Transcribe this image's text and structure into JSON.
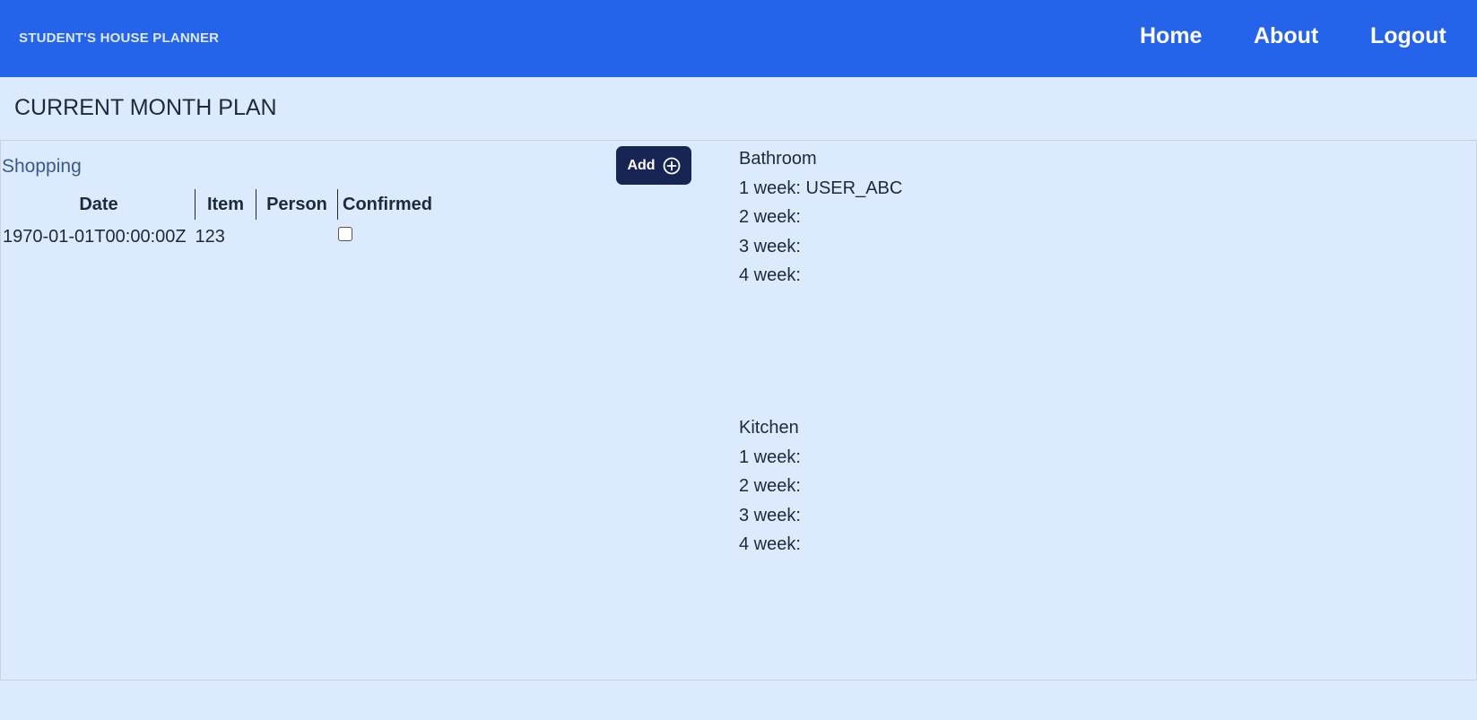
{
  "header": {
    "brand": "STUDENT'S HOUSE PLANNER",
    "nav": [
      "Home",
      "About",
      "Logout"
    ]
  },
  "page_title": "CURRENT MONTH PLAN",
  "shopping": {
    "title": "Shopping",
    "add_label": "Add",
    "columns": [
      "Date",
      "Item",
      "Person",
      "Confirmed"
    ],
    "rows": [
      {
        "date": "1970-01-01T00:00:00Z",
        "item": "123",
        "person": "",
        "confirmed": false
      }
    ]
  },
  "chores": [
    {
      "room": "Bathroom",
      "weeks": [
        {
          "label": "1 week:",
          "assignee": "USER_ABC"
        },
        {
          "label": "2 week:",
          "assignee": ""
        },
        {
          "label": "3 week:",
          "assignee": ""
        },
        {
          "label": "4 week:",
          "assignee": ""
        }
      ]
    },
    {
      "room": "Kitchen",
      "weeks": [
        {
          "label": "1 week:",
          "assignee": ""
        },
        {
          "label": "2 week:",
          "assignee": ""
        },
        {
          "label": "3 week:",
          "assignee": ""
        },
        {
          "label": "4 week:",
          "assignee": ""
        }
      ]
    }
  ],
  "colors": {
    "navbar": "#2563eb",
    "background": "#dbeafe",
    "button": "#172554"
  },
  "icons": {
    "add": "plus-circle-icon"
  }
}
